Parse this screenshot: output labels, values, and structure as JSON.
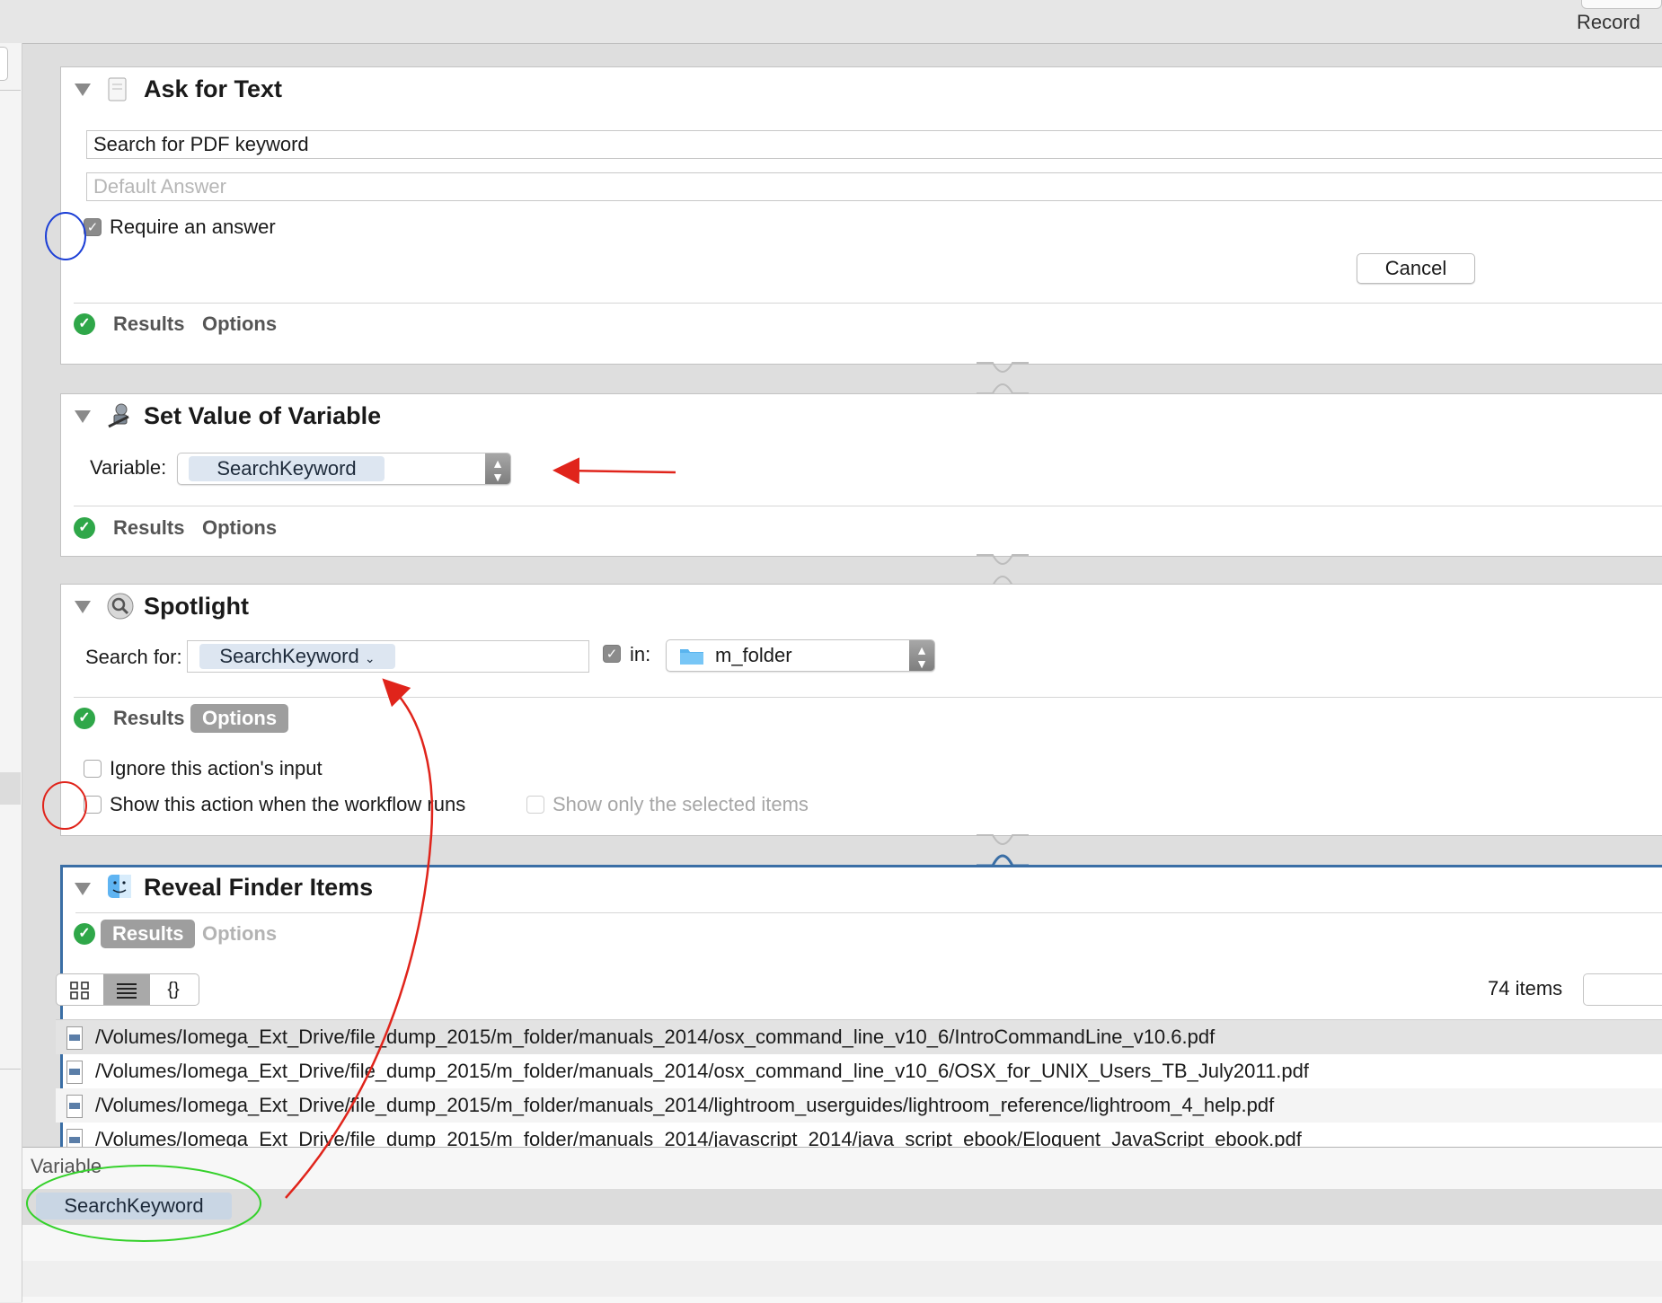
{
  "toolbar": {
    "record_label": "Record"
  },
  "ask_for_text": {
    "title": "Ask for Text",
    "question_value": "Search for PDF keyword",
    "default_answer_placeholder": "Default Answer",
    "require_answer_label": "Require an answer",
    "require_answer_checked": true,
    "cancel_label": "Cancel",
    "results_tab": "Results",
    "options_tab": "Options"
  },
  "set_value": {
    "title": "Set Value of Variable",
    "variable_label": "Variable:",
    "variable_value": "SearchKeyword",
    "results_tab": "Results",
    "options_tab": "Options"
  },
  "spotlight": {
    "title": "Spotlight",
    "search_for_label": "Search for:",
    "search_token": "SearchKeyword",
    "in_label": "in:",
    "in_checked": true,
    "folder_value": "m_folder",
    "results_tab": "Results",
    "options_tab": "Options",
    "ignore_input_label": "Ignore this action's input",
    "show_action_label": "Show this action when the workflow runs",
    "show_selected_label": "Show only the selected items"
  },
  "reveal": {
    "title": "Reveal Finder Items",
    "results_tab": "Results",
    "options_tab": "Options",
    "view_icons": [
      "grid-view-icon",
      "list-view-icon",
      "braces-view-icon"
    ],
    "braces_label": "{}",
    "items_count": "74 items",
    "rows": [
      "/Volumes/Iomega_Ext_Drive/file_dump_2015/m_folder/manuals_2014/osx_command_line_v10_6/IntroCommandLine_v10.6.pdf",
      "/Volumes/Iomega_Ext_Drive/file_dump_2015/m_folder/manuals_2014/osx_command_line_v10_6/OSX_for_UNIX_Users_TB_July2011.pdf",
      "/Volumes/Iomega_Ext_Drive/file_dump_2015/m_folder/manuals_2014/lightroom_userguides/lightroom_reference/lightroom_4_help.pdf",
      "/Volumes/Iomega_Ext_Drive/file_dump_2015/m_folder/manuals_2014/javascript_2014/java_script_ebook/Eloquent_JavaScript_ebook.pdf"
    ]
  },
  "variables_pane": {
    "header": "Variable",
    "items": [
      "SearchKeyword"
    ]
  },
  "annotation_colors": {
    "red": "#e0241b",
    "blue": "#1c3fd6",
    "green": "#35d12b"
  }
}
